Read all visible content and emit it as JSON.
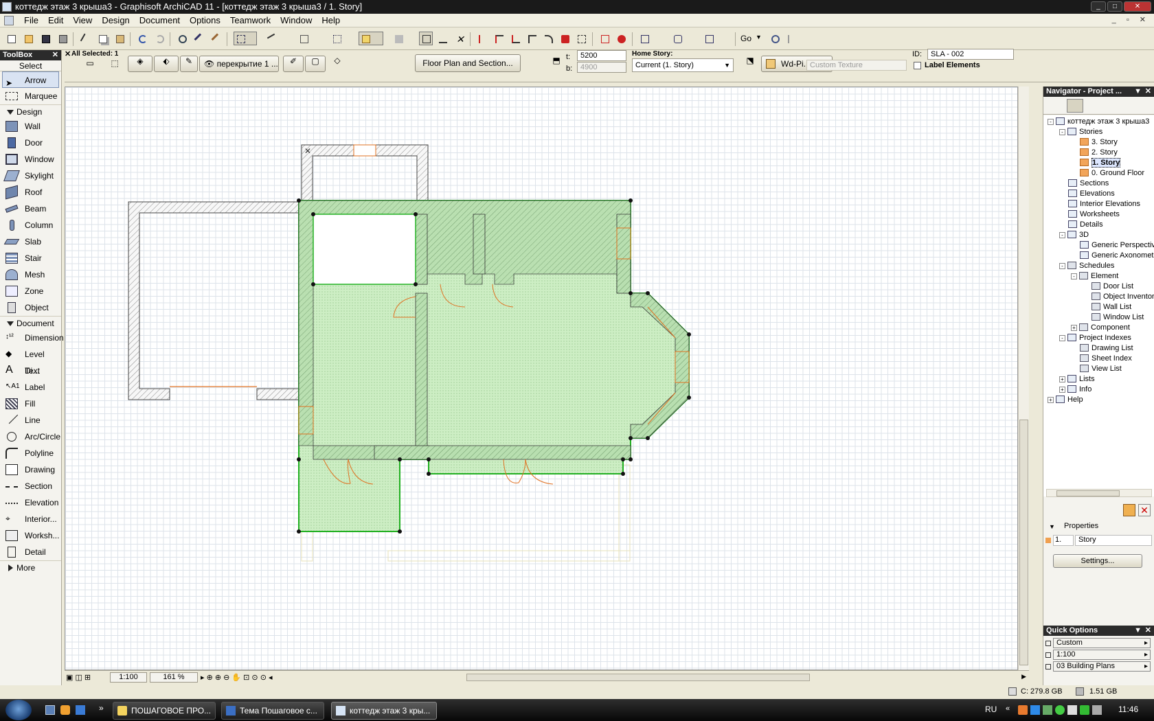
{
  "window": {
    "title": "коттедж этаж 3 крыша3 - Graphisoft ArchiCAD 11 - [коттедж этаж 3 крыша3 / 1. Story]"
  },
  "menu": [
    "File",
    "Edit",
    "View",
    "Design",
    "Document",
    "Options",
    "Teamwork",
    "Window",
    "Help"
  ],
  "toolbar": {
    "go_label": "Go"
  },
  "infobox": {
    "selection": "All Selected: 1",
    "layer_value": "перекрытие 1 ...",
    "floorplan_button": "Floor Plan and Section...",
    "t_label": "t:",
    "t_value": "5200",
    "b_label": "b:",
    "b_value": "4900",
    "home_story_label": "Home Story:",
    "home_story_value": "Current (1. Story)",
    "material_value": "Wd-Pi...",
    "custom_texture": "Custom Texture",
    "id_label": "ID:",
    "id_value": "SLA - 002",
    "label_elements": "Label Elements"
  },
  "toolbox": {
    "title": "ToolBox",
    "select": "Select",
    "arrow": "Arrow",
    "marquee": "Marquee",
    "design_group": "Design",
    "design_tools": [
      "Wall",
      "Door",
      "Window",
      "Skylight",
      "Roof",
      "Beam",
      "Column",
      "Slab",
      "Stair",
      "Mesh",
      "Zone",
      "Object"
    ],
    "document_group": "Document",
    "document_tools": [
      "Dimension",
      "Level Di...",
      "Text",
      "Label",
      "Fill",
      "Line",
      "Arc/Circle",
      "Polyline",
      "Drawing",
      "Section",
      "Elevation",
      "Interior...",
      "Worksh...",
      "Detail"
    ],
    "more": "More"
  },
  "statusbar": {
    "scale": "1:100",
    "zoom": "161 %"
  },
  "navigator": {
    "title": "Navigator - Project ...",
    "tree": [
      {
        "label": "коттедж этаж 3 крыша3",
        "depth": 0,
        "icon": "house",
        "exp": "-"
      },
      {
        "label": "Stories",
        "depth": 1,
        "icon": "stories",
        "exp": "-"
      },
      {
        "label": "3. Story",
        "depth": 2,
        "icon": "folder",
        "exp": ""
      },
      {
        "label": "2. Story",
        "depth": 2,
        "icon": "folder",
        "exp": ""
      },
      {
        "label": "1. Story",
        "depth": 2,
        "icon": "folder",
        "exp": "",
        "selected": true
      },
      {
        "label": "0. Ground Floor",
        "depth": 2,
        "icon": "folder",
        "exp": ""
      },
      {
        "label": "Sections",
        "depth": 1,
        "icon": "view",
        "exp": ""
      },
      {
        "label": "Elevations",
        "depth": 1,
        "icon": "view",
        "exp": ""
      },
      {
        "label": "Interior Elevations",
        "depth": 1,
        "icon": "view",
        "exp": ""
      },
      {
        "label": "Worksheets",
        "depth": 1,
        "icon": "view",
        "exp": ""
      },
      {
        "label": "Details",
        "depth": 1,
        "icon": "view",
        "exp": ""
      },
      {
        "label": "3D",
        "depth": 1,
        "icon": "view",
        "exp": "-"
      },
      {
        "label": "Generic Perspective",
        "depth": 2,
        "icon": "cam",
        "exp": ""
      },
      {
        "label": "Generic Axonometry",
        "depth": 2,
        "icon": "cube",
        "exp": ""
      },
      {
        "label": "Schedules",
        "depth": 1,
        "icon": "table",
        "exp": "-"
      },
      {
        "label": "Element",
        "depth": 2,
        "icon": "table",
        "exp": "-"
      },
      {
        "label": "Door List",
        "depth": 3,
        "icon": "table",
        "exp": ""
      },
      {
        "label": "Object Inventory",
        "depth": 3,
        "icon": "table",
        "exp": ""
      },
      {
        "label": "Wall List",
        "depth": 3,
        "icon": "table",
        "exp": ""
      },
      {
        "label": "Window List",
        "depth": 3,
        "icon": "table",
        "exp": ""
      },
      {
        "label": "Component",
        "depth": 2,
        "icon": "table",
        "exp": "+"
      },
      {
        "label": "Project Indexes",
        "depth": 1,
        "icon": "view",
        "exp": "-"
      },
      {
        "label": "Drawing List",
        "depth": 2,
        "icon": "table",
        "exp": ""
      },
      {
        "label": "Sheet Index",
        "depth": 2,
        "icon": "table",
        "exp": ""
      },
      {
        "label": "View List",
        "depth": 2,
        "icon": "table",
        "exp": ""
      },
      {
        "label": "Lists",
        "depth": 1,
        "icon": "view",
        "exp": "+"
      },
      {
        "label": "Info",
        "depth": 1,
        "icon": "view",
        "exp": "+"
      },
      {
        "label": "Help",
        "depth": 0,
        "icon": "view",
        "exp": "+"
      }
    ],
    "properties_label": "Properties",
    "prop_number": "1.",
    "prop_name": "Story",
    "settings_button": "Settings..."
  },
  "quick_options": {
    "title": "Quick Options",
    "rows": [
      "Custom",
      "1:100",
      "03 Building Plans"
    ]
  },
  "system": {
    "disk": "C: 279.8 GB",
    "memory": "1.51 GB"
  },
  "taskbar": {
    "tasks": [
      "ПОШАГОВОЕ ПРО...",
      "Тема Пошаговое с...",
      "коттедж этаж 3 кры..."
    ],
    "lang": "RU",
    "clock": "11:46"
  },
  "colors": {
    "slab_fill": "#cdeec4",
    "slab_outline": "#22b022",
    "door_swing": "#e07020",
    "grid": "#dde3ea"
  }
}
